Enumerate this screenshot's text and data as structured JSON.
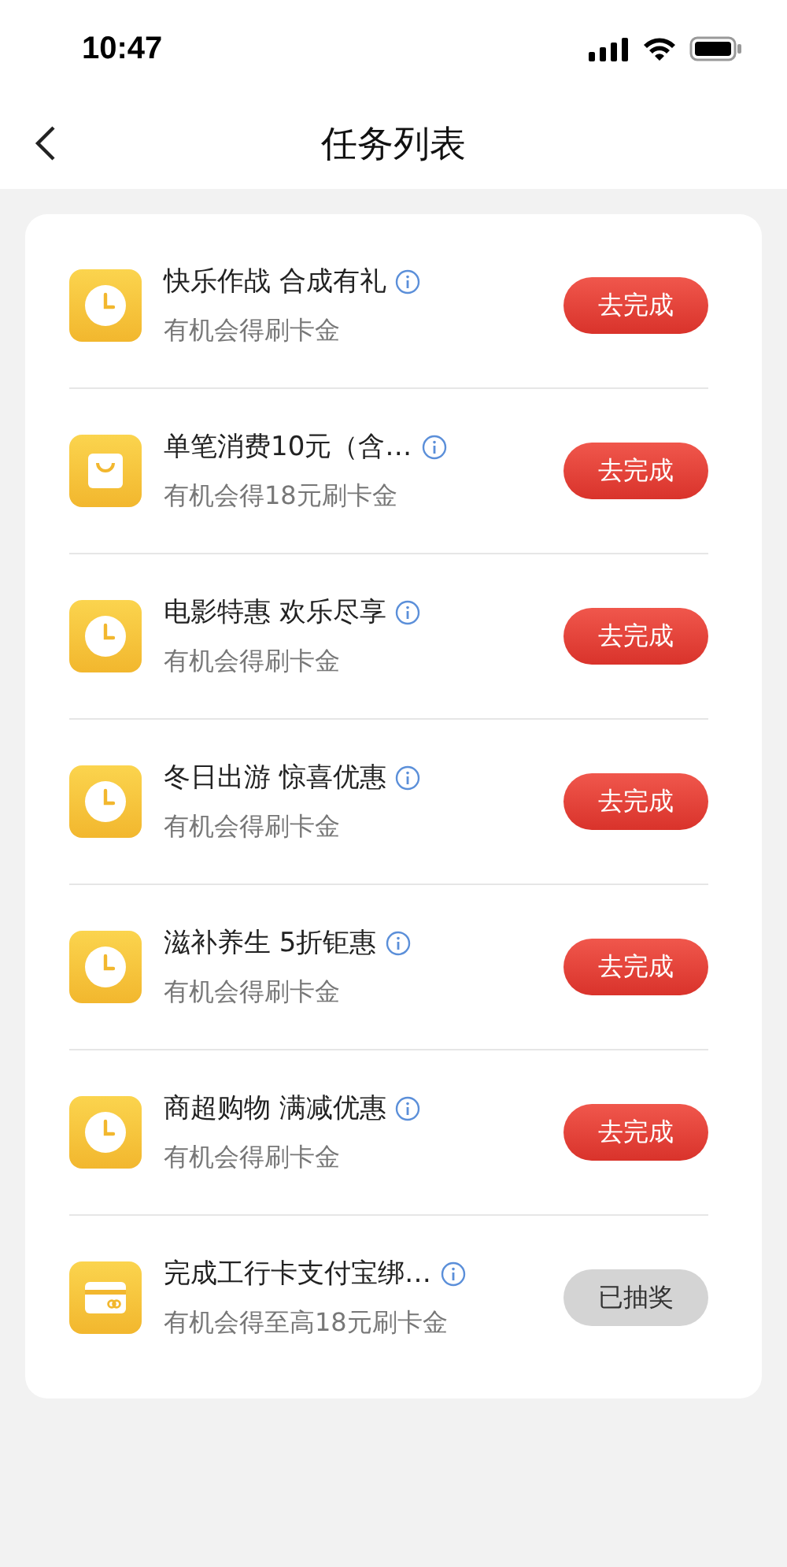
{
  "status_bar": {
    "time": "10:47"
  },
  "nav": {
    "title": "任务列表"
  },
  "tasks": [
    {
      "kind": "clock",
      "title": "快乐作战 合成有礼",
      "subtitle": "有机会得刷卡金",
      "button": "去完成",
      "done": false
    },
    {
      "kind": "bag",
      "title": "单笔消费10元（含…",
      "subtitle": "有机会得18元刷卡金",
      "button": "去完成",
      "done": false
    },
    {
      "kind": "clock",
      "title": "电影特惠 欢乐尽享",
      "subtitle": "有机会得刷卡金",
      "button": "去完成",
      "done": false
    },
    {
      "kind": "clock",
      "title": "冬日出游 惊喜优惠",
      "subtitle": "有机会得刷卡金",
      "button": "去完成",
      "done": false
    },
    {
      "kind": "clock",
      "title": "滋补养生 5折钜惠",
      "subtitle": "有机会得刷卡金",
      "button": "去完成",
      "done": false
    },
    {
      "kind": "clock",
      "title": "商超购物 满减优惠",
      "subtitle": "有机会得刷卡金",
      "button": "去完成",
      "done": false
    },
    {
      "kind": "card",
      "title": "完成工行卡支付宝绑…",
      "subtitle": "有机会得至高18元刷卡金",
      "button": "已抽奖",
      "done": true
    }
  ]
}
